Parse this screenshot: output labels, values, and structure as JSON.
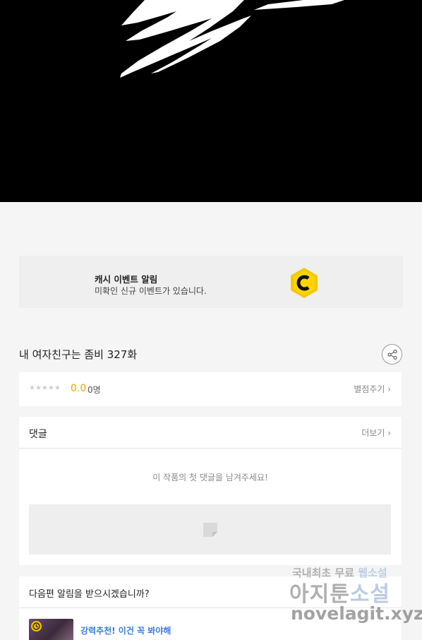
{
  "cash_event": {
    "title": "캐시 이벤트 알림",
    "description": "미확인 신규 이벤트가 있습니다.",
    "icon": "cash-c-icon",
    "icon_color": "#f5c800"
  },
  "episode": {
    "title": "내 여자친구는 좀비 327화",
    "share_icon": "share-icon"
  },
  "rating": {
    "stars": "★★★★★",
    "score": "0.0",
    "count": "0명",
    "rate_link": "별점주기 ›",
    "score_color": "#e8a400"
  },
  "comments": {
    "heading": "댓글",
    "more_link": "더보기 ›",
    "empty_message": "이 작품의 첫 댓글을 남겨주세요!",
    "input_icon": "note-icon"
  },
  "notify": {
    "question": "다음편 알림을 받으시겠습니까?",
    "recommendation": "강력추천! 이건 꼭 봐야해",
    "recommendation_color": "#3b7de0"
  },
  "watermark": {
    "line1_prefix": "국내최초 무료 ",
    "line1_highlight": "웹소설",
    "line2_prefix": "아지툰",
    "line2_highlight": "소설",
    "line3": "novelagit.xyz"
  }
}
